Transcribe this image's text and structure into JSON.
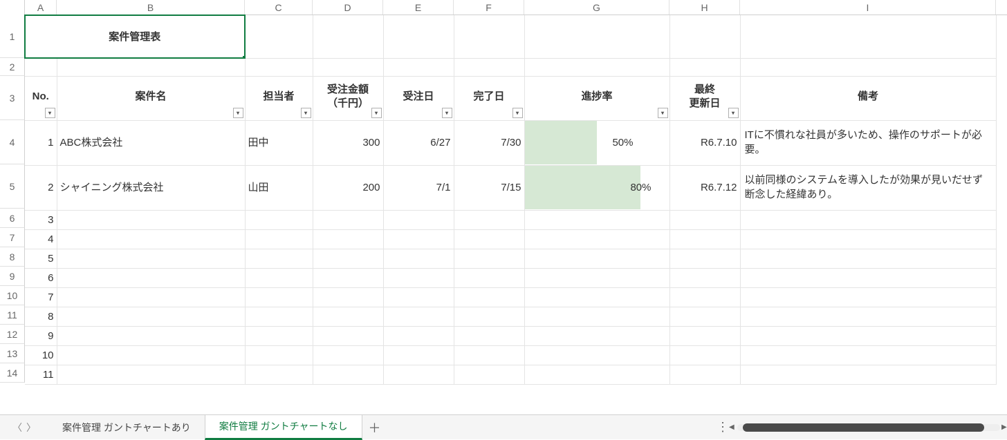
{
  "columns": [
    "A",
    "B",
    "C",
    "D",
    "E",
    "F",
    "G",
    "H",
    "I"
  ],
  "row_numbers": [
    1,
    2,
    3,
    4,
    5,
    6,
    7,
    8,
    9,
    10,
    11,
    12,
    13,
    14
  ],
  "title": "案件管理表",
  "header_row": {
    "no": "No.",
    "project": "案件名",
    "owner": "担当者",
    "amount_l1": "受注金額",
    "amount_l2": "（千円）",
    "order_date": "受注日",
    "complete_date": "完了日",
    "progress": "進捗率",
    "updated_l1": "最終",
    "updated_l2": "更新日",
    "notes": "備考"
  },
  "rows": [
    {
      "no": "1",
      "project": "ABC株式会社",
      "owner": "田中",
      "amount": "300",
      "order": "6/27",
      "complete": "7/30",
      "progress": "50%",
      "updated": "R6.7.10",
      "notes": "ITに不慣れな社員が多いため、操作のサポートが必要。"
    },
    {
      "no": "2",
      "project": "シャイニング株式会社",
      "owner": "山田",
      "amount": "200",
      "order": "7/1",
      "complete": "7/15",
      "progress": "80%",
      "updated": "R6.7.12",
      "notes": "以前同様のシステムを導入したが効果が見いだせず断念した経緯あり。"
    },
    {
      "no": "3"
    },
    {
      "no": "4"
    },
    {
      "no": "5"
    },
    {
      "no": "6"
    },
    {
      "no": "7"
    },
    {
      "no": "8"
    },
    {
      "no": "9"
    },
    {
      "no": "10"
    },
    {
      "no": "11"
    }
  ],
  "tabs": {
    "tab1": "案件管理 ガントチャートあり",
    "tab2": "案件管理  ガントチャートなし",
    "add": "＋"
  }
}
